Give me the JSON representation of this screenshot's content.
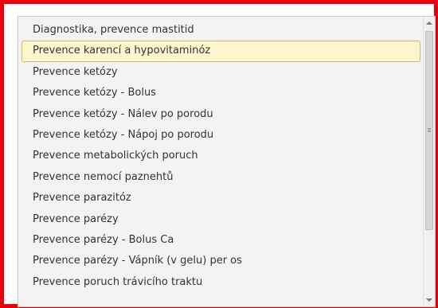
{
  "dropdown": {
    "selected_index": 1,
    "items": [
      {
        "label": "Diagnostika, prevence mastitid"
      },
      {
        "label": "Prevence karencí a hypovitaminóz"
      },
      {
        "label": "Prevence ketózy"
      },
      {
        "label": "Prevence ketózy - Bolus"
      },
      {
        "label": "Prevence ketózy - Nálev po porodu"
      },
      {
        "label": "Prevence ketózy - Nápoj po porodu"
      },
      {
        "label": "Prevence metabolických poruch"
      },
      {
        "label": "Prevence nemocí paznehtů"
      },
      {
        "label": "Prevence parazitóz"
      },
      {
        "label": "Prevence parézy"
      },
      {
        "label": "Prevence parézy - Bolus Ca"
      },
      {
        "label": "Prevence parézy - Vápník (v gelu) per os"
      },
      {
        "label": "Prevence poruch trávicího traktu"
      }
    ]
  },
  "colors": {
    "frame_border": "#e8000b",
    "selected_background": "#fdf6cf",
    "selected_border": "#d7b768"
  },
  "icons": {
    "scroll_up": "scroll-up-arrow-icon",
    "scroll_down": "scroll-down-arrow-icon"
  }
}
